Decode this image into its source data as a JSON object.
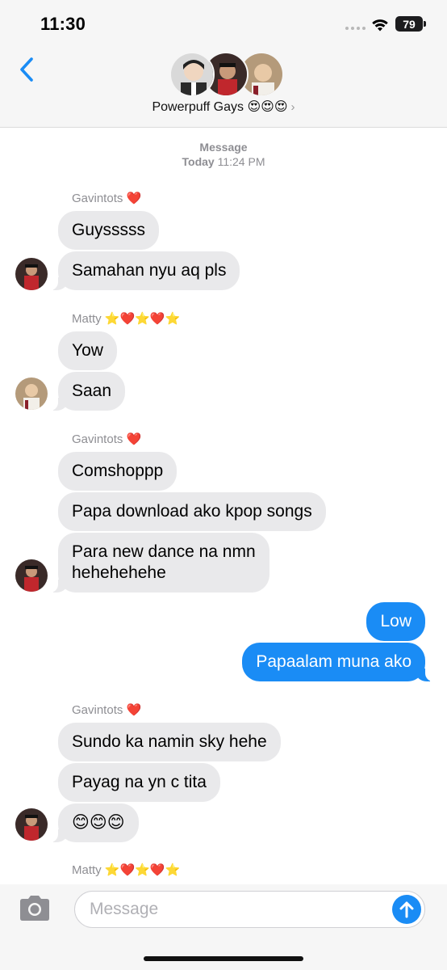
{
  "status_bar": {
    "time": "11:30",
    "battery": "79"
  },
  "header": {
    "back_icon": "chevron-left-icon",
    "group_name": "Powerpuff Gays 😍😍😍",
    "chevron": "›"
  },
  "timestamp": {
    "line1": "Message",
    "today": "Today",
    "time": "11:24 PM"
  },
  "messages": {
    "s1": "Gavintots ❤️",
    "m1": "Guysssss",
    "m2": "Samahan nyu aq pls",
    "s2": "Matty ⭐️❤️⭐️❤️⭐️",
    "m3": "Yow",
    "m4": "Saan",
    "s3": "Gavintots ❤️",
    "m5": "Comshoppp",
    "m6": "Papa download ako kpop songs",
    "m7a": "Para new dance na nmn",
    "m7b": "hehehehehe",
    "m8": "Low",
    "m9": "Papaalam muna ako",
    "s4": "Gavintots ❤️",
    "m10": "Sundo ka namin sky hehe",
    "m11": "Payag na yn c tita",
    "m12": "😊😊😊",
    "s5": "Matty ⭐️❤️⭐️❤️⭐️"
  },
  "composer": {
    "placeholder": "Message"
  },
  "colors": {
    "outgoing": "#1a8cf5",
    "incoming": "#e9e9eb",
    "accent": "#1a8cf5"
  }
}
